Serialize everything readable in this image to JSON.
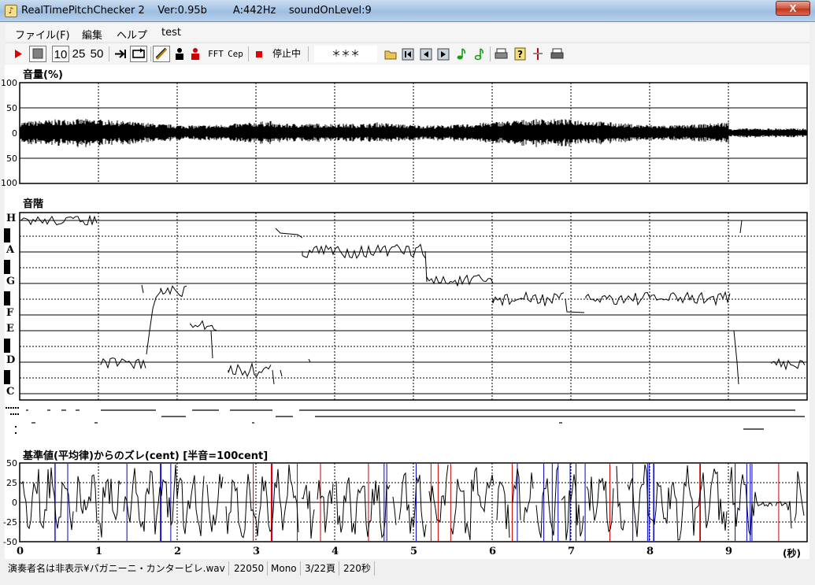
{
  "window": {
    "title": "RealTimePitchChecker 2    Ver:0.95b        A:442Hz    soundOnLevel:9",
    "close_label": "X"
  },
  "menu": [
    "ファイル(F)",
    "編集",
    "ヘルプ",
    "test"
  ],
  "toolbar": {
    "play_icon": "play-icon",
    "stop_icon": "stop-icon",
    "speeds": [
      "10",
      "25",
      "50"
    ],
    "fft_label": "FFT",
    "cep_label": "Cep",
    "status_label": "停止中",
    "marks_label": "＊＊＊",
    "accent_red": "#e00000",
    "accent_green": "#12a012"
  },
  "volume_panel": {
    "title": "音量(%)",
    "y_ticks": [
      "100",
      "50",
      "0",
      "50",
      "100"
    ]
  },
  "scale_panel": {
    "title": "音階",
    "notes": [
      "H",
      "A",
      "G",
      "F",
      "E",
      "D",
      "C"
    ]
  },
  "deviation_panel": {
    "title": "基準値(平均律)からのズレ(cent) [半音=100cent]",
    "y_ticks": [
      "50",
      "25",
      "0",
      "-25",
      "-50"
    ]
  },
  "time_axis": {
    "ticks": [
      "0",
      "1",
      "2",
      "3",
      "4",
      "5",
      "6",
      "7",
      "8",
      "9"
    ],
    "unit": "(秒)"
  },
  "status": {
    "file": "演奏者名は非表示¥パガニーニ・カンタービレ.wav",
    "rate": "22050",
    "channels": "Mono",
    "page": "3/22頁",
    "duration": "220秒"
  },
  "colors": {
    "trace": "#000000",
    "dev_red": "#cc0000",
    "dev_blue": "#0000cc"
  }
}
